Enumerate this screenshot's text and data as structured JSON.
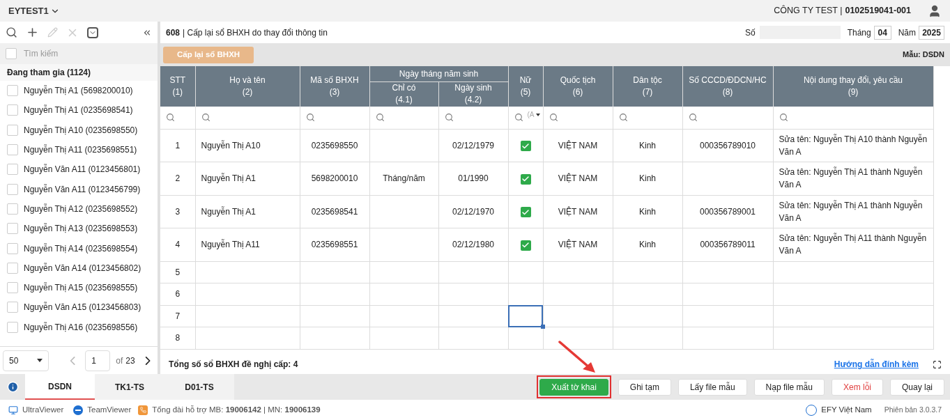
{
  "top_bar": {
    "account": "EYTEST1",
    "company": "CÔNG TY TEST |",
    "tax_code": "0102519041-001"
  },
  "sidebar": {
    "select_all_checked": false,
    "search_placeholder": "Tìm kiếm",
    "group": "Đang tham gia (1124)",
    "items": [
      {
        "label": "Nguyễn Thị A1 (5698200010)",
        "checked": false
      },
      {
        "label": "Nguyễn Thị A1 (0235698541)",
        "checked": false
      },
      {
        "label": "Nguyễn Thị A10 (0235698550)",
        "checked": false
      },
      {
        "label": "Nguyễn Thị A11 (0235698551)",
        "checked": false
      },
      {
        "label": "Nguyễn Văn A11 (0123456801)",
        "checked": false
      },
      {
        "label": "Nguyễn Văn A11 (0123456799)",
        "checked": false
      },
      {
        "label": "Nguyễn Thị A12 (0235698552)",
        "checked": false
      },
      {
        "label": "Nguyễn Thị A13 (0235698553)",
        "checked": false
      },
      {
        "label": "Nguyễn Thị A14 (0235698554)",
        "checked": false
      },
      {
        "label": "Nguyễn Văn A14 (0123456802)",
        "checked": false
      },
      {
        "label": "Nguyễn Thị A15 (0235698555)",
        "checked": false
      },
      {
        "label": "Nguyễn Văn A15 (0123456803)",
        "checked": false
      },
      {
        "label": "Nguyễn Thị A16 (0235698556)",
        "checked": false
      }
    ],
    "pagination": {
      "page_size": "50",
      "page": "1",
      "of_label": "of",
      "total_pages": "23"
    }
  },
  "form": {
    "title_code": "608",
    "title": "| Cấp lại sổ BHXH do thay đổi thông tin",
    "number_label": "Số",
    "month_label": "Tháng",
    "month": "04",
    "year_label": "Năm",
    "year": "2025",
    "action": "Cấp lại sổ BHXH",
    "template": "Mẫu: DSDN"
  },
  "table": {
    "group_header": "Ngày tháng năm sinh",
    "columns": [
      {
        "label": "STT",
        "number": "(1)"
      },
      {
        "label": "Họ và tên",
        "number": "(2)"
      },
      {
        "label": "Mã số BHXH",
        "number": "(3)"
      },
      {
        "label": "Chỉ có",
        "number": "(4.1)"
      },
      {
        "label": "Ngày sinh",
        "number": "(4.2)"
      },
      {
        "label": "Nữ",
        "number": "(5)",
        "filter_value": "(A"
      },
      {
        "label": "Quốc tịch",
        "number": "(6)"
      },
      {
        "label": "Dân tộc",
        "number": "(7)"
      },
      {
        "label": "Số CCCD/ĐDCN/HC",
        "number": "(8)"
      },
      {
        "label": "Nội dung thay đổi, yêu cầu",
        "number": "(9)"
      }
    ],
    "rows": [
      {
        "stt": "1",
        "name": "Nguyễn Thị A10",
        "code": "0235698550",
        "dob": "02/12/1979",
        "female": true,
        "nationality": "VIỆT NAM",
        "ethnicity": "Kinh",
        "id_number": "000356789010",
        "change": "Sửa tên: Nguyễn Thị A10 thành Nguyễn Văn A",
        "selected": false
      },
      {
        "stt": "2",
        "name": "Nguyễn Thị A1",
        "code": "5698200010",
        "year_only": "Tháng/năm",
        "dob": "01/1990",
        "female": true,
        "nationality": "VIỆT NAM",
        "ethnicity": "Kinh",
        "change": "Sửa tên: Nguyễn Thị A1 thành Nguyễn Văn A",
        "selected": false
      },
      {
        "stt": "3",
        "name": "Nguyễn Thị A1",
        "code": "0235698541",
        "dob": "02/12/1970",
        "female": true,
        "nationality": "VIỆT NAM",
        "ethnicity": "Kinh",
        "id_number": "000356789001",
        "change": "Sửa tên: Nguyễn Thị A1 thành Nguyễn Văn A",
        "selected": false
      },
      {
        "stt": "4",
        "name": "Nguyễn Thị A11",
        "code": "0235698551",
        "dob": "02/12/1980",
        "female": true,
        "nationality": "VIỆT NAM",
        "ethnicity": "Kinh",
        "id_number": "000356789011",
        "change": "Sửa tên: Nguyễn Thị A11 thành Nguyễn Văn A",
        "selected": false
      },
      {
        "stt": "5",
        "selected": false
      },
      {
        "stt": "6",
        "selected": false
      },
      {
        "stt": "7",
        "selected": true
      },
      {
        "stt": "8",
        "selected": false
      }
    ],
    "total": "Tổng số sổ BHXH đề nghị cấp: 4",
    "help_link": "Hướng dẫn đính kèm"
  },
  "tabs": [
    {
      "label": "DSDN",
      "selected": true
    },
    {
      "label": "TK1-TS",
      "selected": false
    },
    {
      "label": "D01-TS",
      "selected": false
    }
  ],
  "buttons": [
    {
      "label": "Xuất tờ khai",
      "kind": "primary",
      "highlighted": true
    },
    {
      "label": "Ghi tạm",
      "kind": "default",
      "highlighted": false
    },
    {
      "label": "Lấy file mẫu",
      "kind": "default",
      "highlighted": false
    },
    {
      "label": "Nạp file mẫu",
      "kind": "default",
      "highlighted": false
    },
    {
      "label": "Xem lỗi",
      "kind": "danger",
      "highlighted": false
    },
    {
      "label": "Quay lại",
      "kind": "default",
      "highlighted": false
    }
  ],
  "status_bar": {
    "ultraviewer": "UltraViewer",
    "teamviewer": "TeamViewer",
    "support": "Tổng đài hỗ trợ MB: **19006142** | MN: **19006139**",
    "brand": "EFY Việt Nam",
    "version": "Phiên bản 3.0.3.7"
  }
}
